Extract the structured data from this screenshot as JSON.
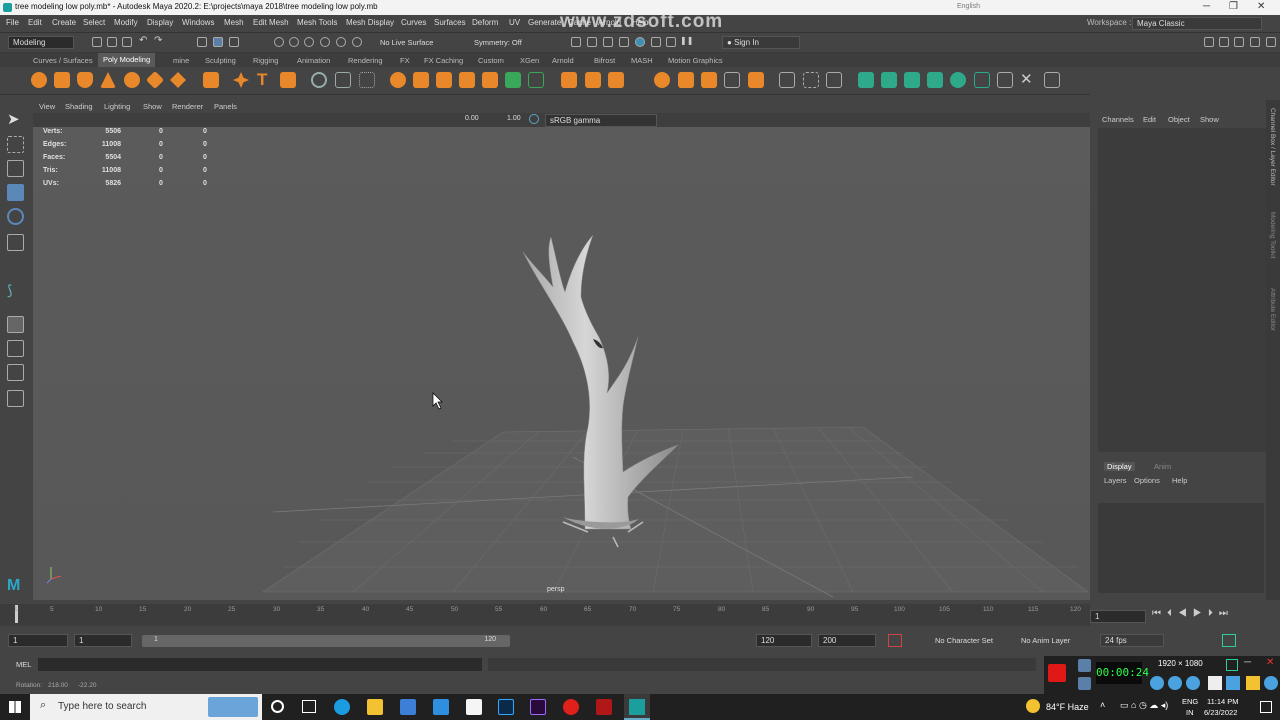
{
  "window": {
    "title": "tree modeling low poly.mb* - Autodesk Maya 2020.2: E:\\projects\\maya 2018\\tree modeling low poly.mb",
    "language": "English",
    "workspace_label": "Workspace :",
    "workspace_value": "Maya Classic"
  },
  "watermark": "www.zdsoft.com",
  "menu": [
    "File",
    "Edit",
    "Create",
    "Select",
    "Modify",
    "Display",
    "Windows",
    "Mesh",
    "Edit Mesh",
    "Mesh Tools",
    "Mesh Display",
    "Curves",
    "Surfaces",
    "Deform",
    "UV",
    "Generate",
    "Cache",
    "Arnold",
    "Help"
  ],
  "status": {
    "mode": "Modeling",
    "live_surface": "No Live Surface",
    "symmetry": "Symmetry: Off",
    "sign_in": "Sign In"
  },
  "shelf_tabs": [
    "Curves / Surfaces",
    "Poly Modeling",
    "mine",
    "Sculpting",
    "Rigging",
    "Animation",
    "Rendering",
    "FX",
    "FX Caching",
    "Custom",
    "XGen",
    "Arnold",
    "Bifrost",
    "MASH",
    "Motion Graphics"
  ],
  "shelf_active_tab": "Poly Modeling",
  "panel_menu": [
    "View",
    "Shading",
    "Lighting",
    "Show",
    "Renderer",
    "Panels"
  ],
  "panel_toolbar": {
    "exposure": "0.00",
    "gamma": "1.00",
    "color_space": "sRGB gamma"
  },
  "hud": [
    {
      "label": "Verts:",
      "a": "5506",
      "b": "0",
      "c": "0"
    },
    {
      "label": "Edges:",
      "a": "11008",
      "b": "0",
      "c": "0"
    },
    {
      "label": "Faces:",
      "a": "5504",
      "b": "0",
      "c": "0"
    },
    {
      "label": "Tris:",
      "a": "11008",
      "b": "0",
      "c": "0"
    },
    {
      "label": "UVs:",
      "a": "5826",
      "b": "0",
      "c": "0"
    }
  ],
  "camera_label": "persp",
  "channel_box": {
    "tabs": [
      "Channels",
      "Edit",
      "Object",
      "Show"
    ]
  },
  "layer_editor": {
    "tabs": [
      "Display",
      "Anim"
    ],
    "menu": [
      "Layers",
      "Options",
      "Help"
    ]
  },
  "side_tabs": [
    "Channel Box / Layer Editor",
    "Modeling Toolkit",
    "Attribute Editor"
  ],
  "timeline": {
    "ticks": [
      "1",
      "5",
      "10",
      "15",
      "20",
      "25",
      "30",
      "35",
      "40",
      "45",
      "50",
      "55",
      "60",
      "65",
      "70",
      "75",
      "80",
      "85",
      "90",
      "95",
      "100",
      "105",
      "110",
      "115",
      "120"
    ],
    "current_frame": "1"
  },
  "range": {
    "start": "1",
    "start2": "1",
    "slider_start": "1",
    "slider_end": "120",
    "end": "120",
    "end2": "200",
    "character_set": "No Character Set",
    "anim_layer": "No Anim Layer",
    "fps": "24 fps"
  },
  "cmdline": {
    "label": "MEL"
  },
  "help_line": {
    "label": "Rotation:",
    "x": "218.00",
    "y": "-22.20"
  },
  "recorder": {
    "resolution": "1920 × 1080",
    "timer": "00:00:24"
  },
  "taskbar": {
    "search_placeholder": "Type here to search",
    "weather": "84°F Haze",
    "lang": "ENG",
    "lang2": "IN",
    "time": "11:14 PM",
    "date": "6/23/2022"
  }
}
